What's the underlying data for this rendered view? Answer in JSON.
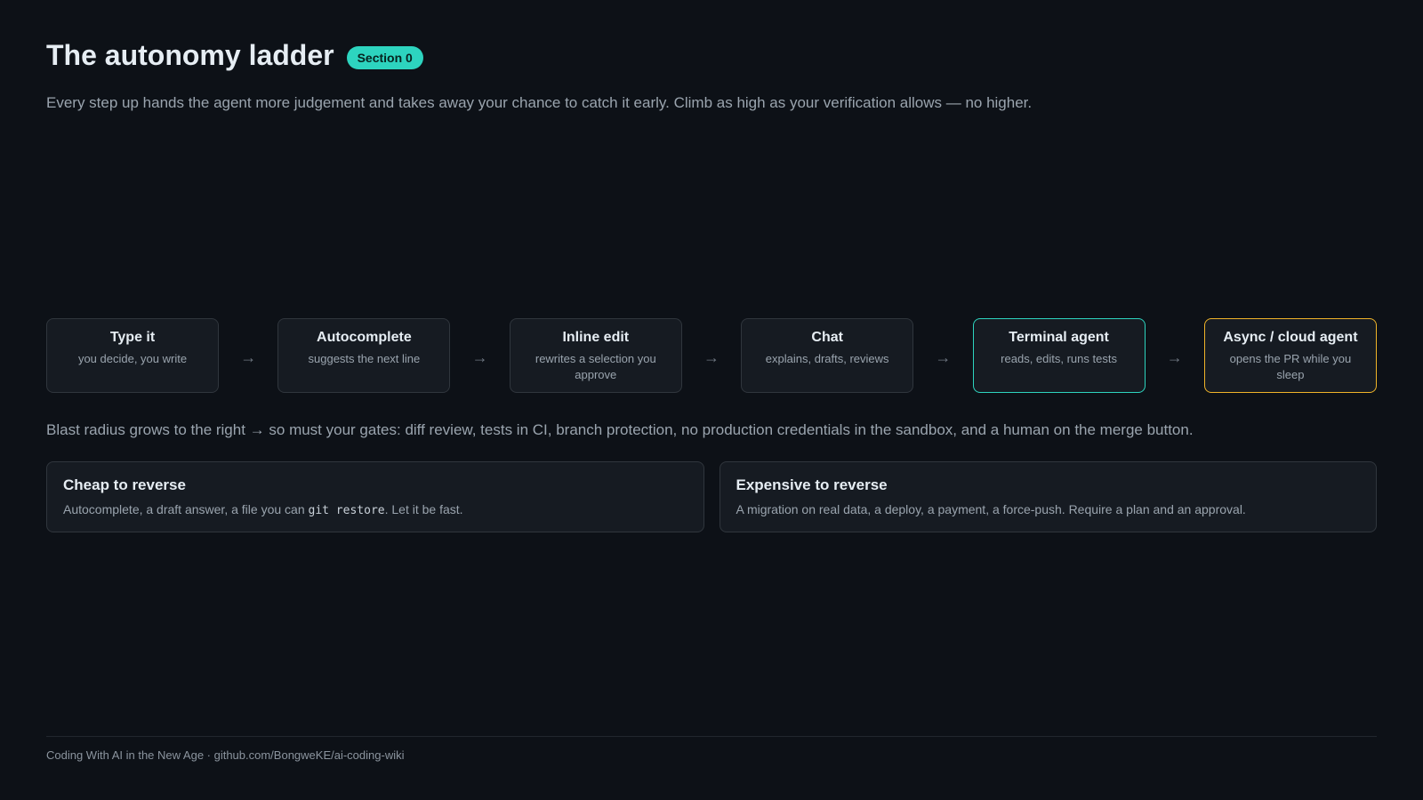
{
  "header": {
    "title": "The autonomy ladder",
    "badge": "Section 0"
  },
  "subtitle": "Every step up hands the agent more judgement and takes away your chance to catch it early. Climb as high as your verification allows — no higher.",
  "ladder": {
    "arrow": "→",
    "steps": [
      {
        "title": "Type it",
        "desc": "you decide, you write"
      },
      {
        "title": "Autocomplete",
        "desc": "suggests the next line"
      },
      {
        "title": "Inline edit",
        "desc": "rewrites a selection you approve"
      },
      {
        "title": "Chat",
        "desc": "explains, drafts, reviews"
      },
      {
        "title": "Terminal agent",
        "desc": "reads, edits, runs tests"
      },
      {
        "title": "Async / cloud agent",
        "desc": "opens the PR while you sleep"
      }
    ]
  },
  "blast_radius": "Blast radius grows to the right → so must your gates: diff review, tests in CI, branch protection, no production credentials in the sandbox, and a human on the merge button.",
  "cards": {
    "cheap": {
      "title": "Cheap to reverse",
      "desc_before": "Autocomplete, a draft answer, a file you can ",
      "desc_code": "git restore",
      "desc_after": ". Let it be fast."
    },
    "expensive": {
      "title": "Expensive to reverse",
      "desc": "A migration on real data, a deploy, a payment, a force-push. Require a plan and an approval."
    }
  },
  "footer": "Coding With AI in the New Age · github.com/BongweKE/ai-coding-wiki",
  "colors": {
    "background": "#0d1117",
    "accent_teal": "#2dd4bf",
    "accent_amber": "#f0b429"
  }
}
